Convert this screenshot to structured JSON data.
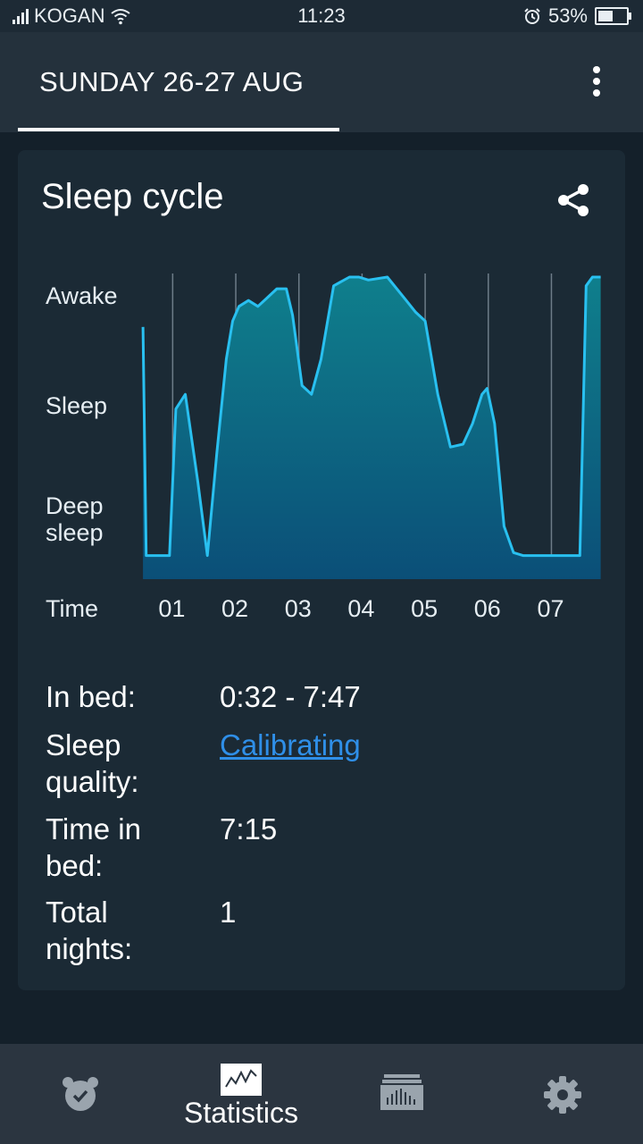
{
  "status_bar": {
    "carrier": "KOGAN",
    "time": "11:23",
    "battery": "53%",
    "battery_level": 0.53
  },
  "header": {
    "date_tab": "SUNDAY 26-27 AUG",
    "menu_icon": "more-vert-icon"
  },
  "card": {
    "title": "Sleep cycle",
    "share_icon": "share-icon",
    "y_labels": {
      "awake": "Awake",
      "sleep": "Sleep",
      "deep_sleep": "Deep sleep"
    },
    "x_title": "Time",
    "info": {
      "in_bed_label": "In bed:",
      "in_bed_value": "0:32 - 7:47",
      "quality_label": "Sleep quality:",
      "quality_value": "Calibrating",
      "time_in_bed_label": "Time in bed:",
      "time_in_bed_value": "7:15",
      "total_nights_label": "Total nights:",
      "total_nights_value": "1"
    }
  },
  "chart_data": {
    "type": "area",
    "x_ticks": [
      "01",
      "02",
      "03",
      "04",
      "05",
      "06",
      "07"
    ],
    "x_label": "Time",
    "y_categories": [
      "Deep sleep",
      "Sleep",
      "Awake"
    ],
    "grid": true,
    "x": [
      0.53,
      0.58,
      0.75,
      0.95,
      1.05,
      1.2,
      1.4,
      1.55,
      1.7,
      1.85,
      1.95,
      2.05,
      2.2,
      2.35,
      2.5,
      2.65,
      2.8,
      2.9,
      3.05,
      3.2,
      3.35,
      3.55,
      3.8,
      3.95,
      4.1,
      4.4,
      4.7,
      4.85,
      5.0,
      5.2,
      5.4,
      5.6,
      5.75,
      5.9,
      5.98,
      6.1,
      6.25,
      6.4,
      6.55,
      6.7,
      6.85,
      7.05,
      7.25,
      7.45,
      7.55,
      7.65,
      7.78
    ],
    "y": [
      0.83,
      0.05,
      0.05,
      0.05,
      0.55,
      0.6,
      0.3,
      0.05,
      0.4,
      0.72,
      0.85,
      0.9,
      0.92,
      0.9,
      0.93,
      0.96,
      0.96,
      0.87,
      0.63,
      0.6,
      0.72,
      0.97,
      1.0,
      1.0,
      0.99,
      1.0,
      0.92,
      0.88,
      0.85,
      0.6,
      0.42,
      0.43,
      0.5,
      0.6,
      0.62,
      0.5,
      0.15,
      0.06,
      0.05,
      0.05,
      0.05,
      0.05,
      0.05,
      0.05,
      0.97,
      1.0,
      1.0
    ]
  },
  "bottom_nav": {
    "items": [
      {
        "icon": "alarm-clock-icon",
        "label": ""
      },
      {
        "icon": "statistics-chart-icon",
        "label": "Statistics"
      },
      {
        "icon": "sleep-history-icon",
        "label": ""
      },
      {
        "icon": "settings-gear-icon",
        "label": ""
      }
    ]
  },
  "colors": {
    "background": "#14202a",
    "card": "#1b2a35",
    "line": "#29c0f0",
    "fill_top": "#0f7f8c",
    "fill_bottom": "#0b4f78",
    "link": "#2f8fe8"
  }
}
